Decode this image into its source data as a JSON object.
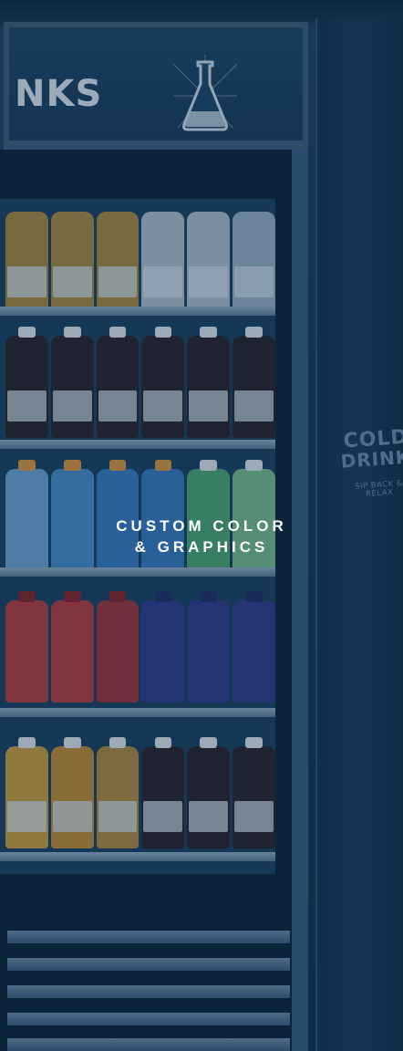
{
  "sign": {
    "header_text": "NKS",
    "side_line1": "COLD",
    "side_line2": "DRINKS",
    "side_tagline": "SIP BACK & RELAX"
  },
  "caption": {
    "line1": "CUSTOM COLOR",
    "line2": "& GRAPHICS"
  },
  "colors": {
    "overlay": "#0f2d4b",
    "caption_text": "#ffffff"
  }
}
